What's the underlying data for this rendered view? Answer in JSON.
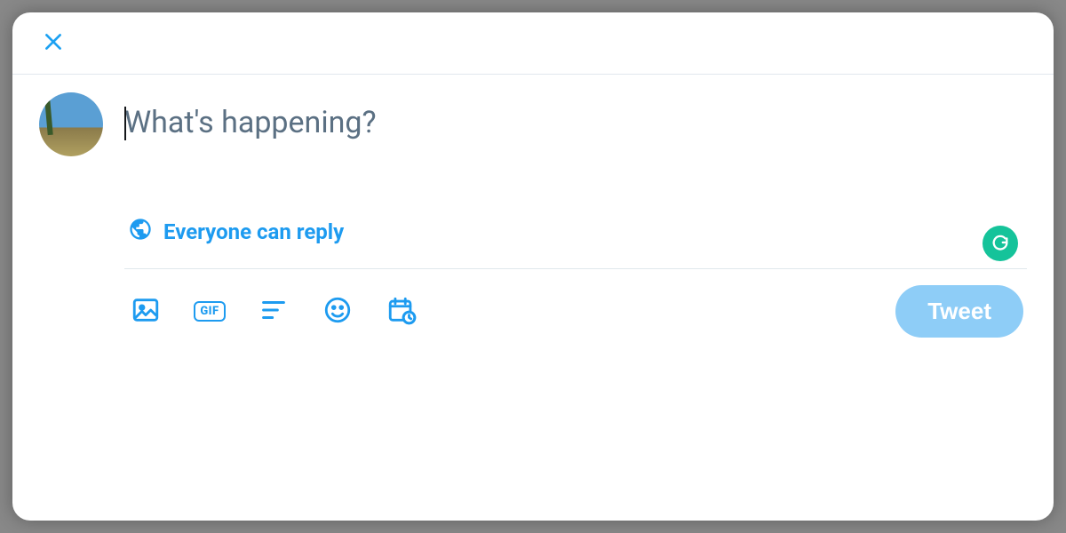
{
  "compose": {
    "placeholder": "What's happening?",
    "value": ""
  },
  "audience": {
    "label": "Everyone can reply"
  },
  "toolbar": {
    "gif_label": "GIF",
    "tweet_label": "Tweet"
  },
  "icons": {
    "close": "close-icon",
    "globe": "globe-icon",
    "image": "image-icon",
    "gif": "gif-icon",
    "poll": "poll-icon",
    "emoji": "emoji-icon",
    "schedule": "schedule-icon",
    "grammarly": "grammarly-icon"
  },
  "colors": {
    "accent": "#1d9bf0",
    "tweet_disabled": "#8ecdf7",
    "grammarly": "#15c39a"
  }
}
